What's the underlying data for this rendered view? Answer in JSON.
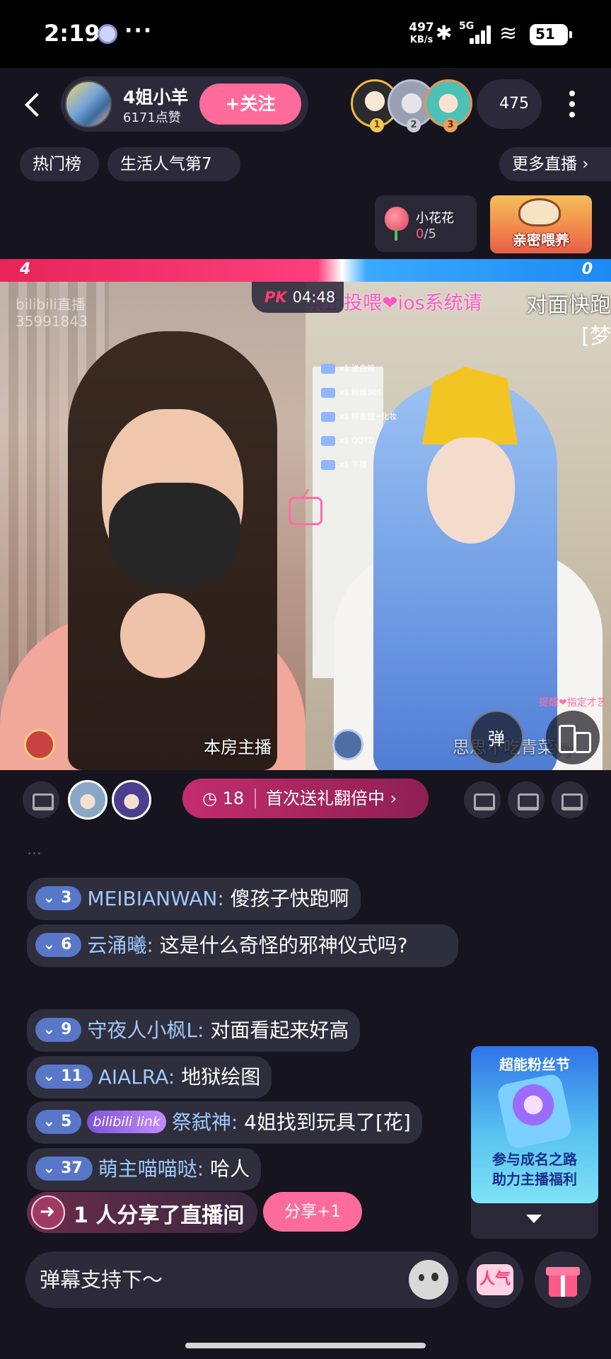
{
  "status_bar": {
    "time": "2:19",
    "more": "···",
    "net_speed": "497",
    "net_unit": "KB/s",
    "network": "5G",
    "battery": "51"
  },
  "header": {
    "streamer_name": "4姐小羊",
    "likes": "6171点赞",
    "follow_label": "+关注",
    "viewer_count": "475",
    "fan_ranks": [
      "1",
      "2",
      "3"
    ]
  },
  "chips": {
    "hot_rank": "热门榜",
    "category_rank": "生活人气第7",
    "more_live": "更多直播 ›"
  },
  "flower_gift": {
    "name": "小花花",
    "count_current": "0",
    "count_total": "/5"
  },
  "feed_banner": {
    "label": "亲密喂养"
  },
  "pk": {
    "score_left": "4",
    "score_right": "0",
    "timer_icon": "PK",
    "timer": "04:48"
  },
  "video_left": {
    "watermark": "bilibili直播",
    "watermark_id": "35991843",
    "anchor_label": "本房主播"
  },
  "video_right": {
    "overlay_pink": "禁止投喂❤ios系统请",
    "overlay_white": "对面快跑",
    "overlay_white2": "[梦",
    "gift_lines": [
      "x1 送白鲸",
      "x1 粉丝30S",
      "x1 好友位+化妆",
      "x1 QQTD",
      "x1 下播"
    ],
    "anchor_label": "思思不吃青菜yy",
    "tag": "提醒❤指定才艺",
    "danmu_toggle": "弹"
  },
  "promo": {
    "timer": "18",
    "text": "首次送礼翻倍中 ›"
  },
  "chat": {
    "faded": "...",
    "messages": [
      {
        "level": "3",
        "user": "MEIBIANWAN:",
        "text": " 傻孩子快跑啊"
      },
      {
        "level": "6",
        "user": "云涌曦:",
        "text": " 这是什么奇怪的邪神仪式吗?"
      },
      {
        "level": "9",
        "user": "守夜人小枫L:",
        "text": " 对面看起来好高"
      },
      {
        "level": "11",
        "user": "AIALRA:",
        "text": " 地狱绘图"
      },
      {
        "level": "5",
        "badge": "bilibili link",
        "user": "祭弑神:",
        "text": " 4姐找到玩具了[花]"
      },
      {
        "level": "37",
        "user": "萌主喵喵哒:",
        "text": " 哈人"
      }
    ]
  },
  "share": {
    "count": "1",
    "text": "人分享了直播间",
    "button": "分享+1"
  },
  "fan_festival": {
    "title": "超能粉丝节",
    "line1": "参与成名之路",
    "line2": "助力主播福利"
  },
  "input": {
    "placeholder": "弹幕支持下～"
  },
  "bottom_buttons": {
    "popularity": "人气"
  },
  "colors": {
    "background": "#16141f",
    "accent_pink": "#ff6b9a",
    "pk_red": "#e8245a",
    "pk_blue": "#1c8af3",
    "username_blue": "#9ec9ff",
    "level_badge": "#5877c9"
  }
}
